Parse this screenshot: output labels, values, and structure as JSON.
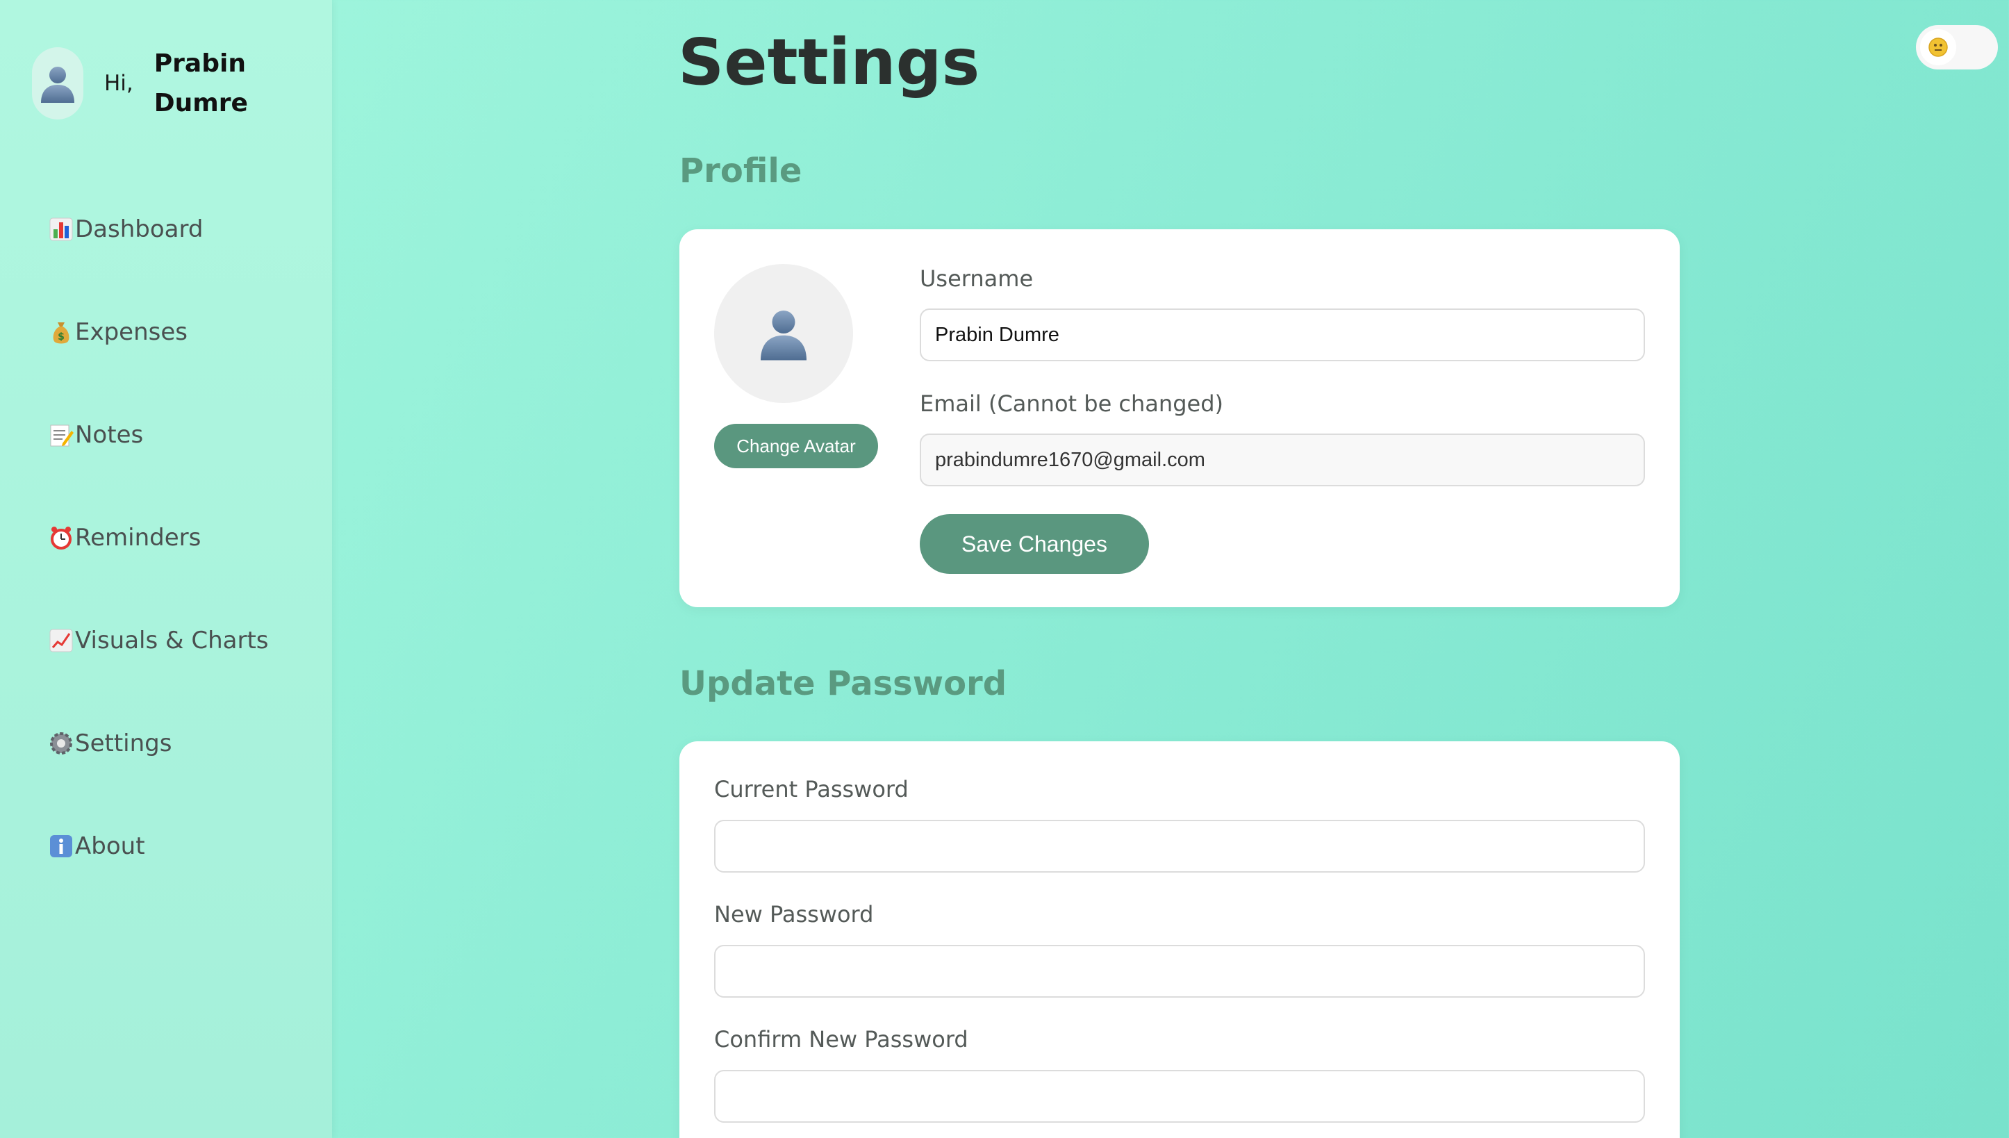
{
  "user": {
    "greeting": "Hi,",
    "name": "Prabin Dumre"
  },
  "nav": {
    "items": [
      {
        "label": "Dashboard",
        "icon": "bar-chart-icon"
      },
      {
        "label": "Expenses",
        "icon": "money-bag-icon"
      },
      {
        "label": "Notes",
        "icon": "memo-icon"
      },
      {
        "label": "Reminders",
        "icon": "alarm-clock-icon"
      },
      {
        "label": "Visuals & Charts",
        "icon": "trend-chart-icon"
      },
      {
        "label": "Settings",
        "icon": "gear-icon"
      },
      {
        "label": "About",
        "icon": "info-icon"
      }
    ]
  },
  "page": {
    "title": "Settings"
  },
  "profile": {
    "heading": "Profile",
    "change_avatar_label": "Change Avatar",
    "username_label": "Username",
    "username_value": "Prabin Dumre",
    "email_label": "Email (Cannot be changed)",
    "email_value": "prabindumre1670@gmail.com",
    "save_label": "Save Changes"
  },
  "password": {
    "heading": "Update Password",
    "current_label": "Current Password",
    "new_label": "New Password",
    "confirm_label": "Confirm New Password"
  },
  "theme_toggle": {
    "icon": "moon-icon",
    "state": "light"
  },
  "colors": {
    "accent": "#5a977f",
    "heading": "#5a9a80",
    "background": "#8eedd6",
    "sidebar": "#aef5de"
  }
}
